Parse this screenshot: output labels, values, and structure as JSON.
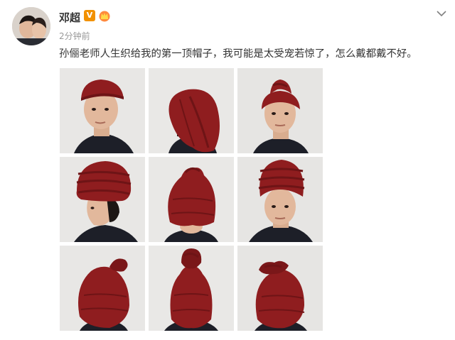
{
  "post": {
    "author": "邓超",
    "verified_label": "V",
    "time": "2分钟前",
    "text": "孙俪老师人生织给我的第一顶帽子，我可能是太受宠若惊了，怎么戴都戴不好。"
  },
  "icons": {
    "avatar": "avatar-photo",
    "verified": "verified-badge-icon",
    "crown": "crown-badge-icon",
    "menu": "chevron-down-icon"
  },
  "colors": {
    "hat": "#8f1d1f",
    "hat_dark": "#6e1416",
    "skin": "#e2b89c",
    "hair": "#1c1614",
    "shirt": "#1d1f28",
    "wall": "#e7e6e4",
    "verified": "#f29100",
    "text": "#333333",
    "muted": "#999999"
  },
  "photos": [
    {
      "id": 1,
      "view": "front-3/4 wearing beanie"
    },
    {
      "id": 2,
      "view": "back of head, slouchy hat"
    },
    {
      "id": 3,
      "view": "front, twisted top knot"
    },
    {
      "id": 4,
      "view": "side profile, stacked hat"
    },
    {
      "id": 5,
      "view": "hat pulled over eyes"
    },
    {
      "id": 6,
      "view": "front, tall stacked hat"
    },
    {
      "id": 7,
      "view": "hat covering whole face, side"
    },
    {
      "id": 8,
      "view": "hat covering whole face, front"
    },
    {
      "id": 9,
      "view": "hat covering whole face, knot top"
    }
  ]
}
